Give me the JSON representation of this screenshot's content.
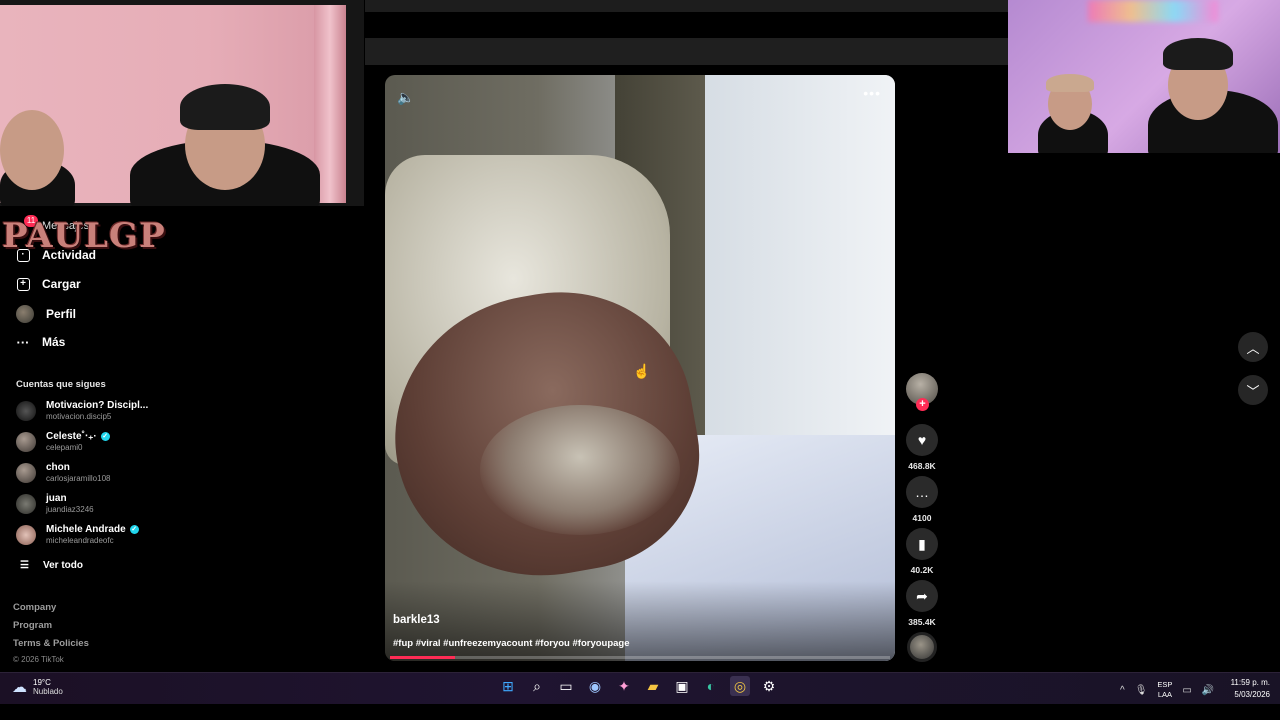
{
  "overlay": {
    "streamer_logo": "PAULGP"
  },
  "sidebar": {
    "messages_label": "Mensajes",
    "messages_badge": "11",
    "nav": [
      {
        "label": "Actividad",
        "icon": "activity-icon"
      },
      {
        "label": "Cargar",
        "icon": "upload-icon"
      },
      {
        "label": "Perfil",
        "icon": "profile-avatar"
      },
      {
        "label": "Más",
        "icon": "more-icon"
      }
    ],
    "following_title": "Cuentas que sigues",
    "accounts": [
      {
        "name": "Motivacion? Discipl...",
        "handle": "motivacion.discip5",
        "verified": false
      },
      {
        "name": "Celeste˚‧₊·",
        "handle": "celepami0",
        "verified": true
      },
      {
        "name": "chon",
        "handle": "carlosjaramillo108",
        "verified": false
      },
      {
        "name": "juan",
        "handle": "juandiaz3246",
        "verified": false
      },
      {
        "name": "Michele Andrade",
        "handle": "micheleandradeofc",
        "verified": true
      }
    ],
    "see_all": "Ver todo",
    "footer": [
      "Company",
      "Program",
      "Terms & Policies"
    ],
    "copyright": "© 2026 TikTok"
  },
  "video": {
    "username": "barkle13",
    "hashtags": "#fup #viral #unfreezemyacount #foryou #foryoupage",
    "progress": 0.13
  },
  "actions": {
    "likes": "468.8K",
    "comments": "4100",
    "saves": "40.2K",
    "shares": "385.4K"
  },
  "taskbar": {
    "weather_temp": "19°C",
    "weather_desc": "Nublado",
    "lang_top": "ESP",
    "lang_bottom": "LAA",
    "time": "11:59 p. m.",
    "date": "5/03/2026"
  },
  "colors": {
    "accent": "#fe2c55",
    "verified": "#20d5ec"
  }
}
